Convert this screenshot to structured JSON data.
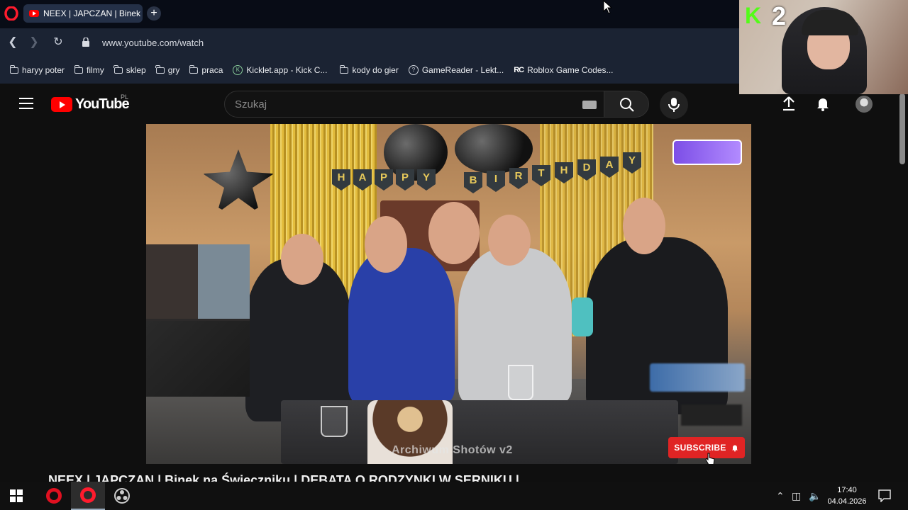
{
  "browser": {
    "tab_title": "NEEX | JAPCZAN | Binek na Świecznik",
    "url": "www.youtube.com/watch"
  },
  "bookmarks": [
    {
      "label": "haryy poter",
      "icon": "folder-icon"
    },
    {
      "label": "filmy",
      "icon": "folder-icon"
    },
    {
      "label": "sklep",
      "icon": "folder-icon"
    },
    {
      "label": "gry",
      "icon": "folder-icon"
    },
    {
      "label": "praca",
      "icon": "folder-icon"
    },
    {
      "label": "Kicklet.app - Kick C...",
      "icon": "kicklet-icon"
    },
    {
      "label": "kody do gier",
      "icon": "folder-icon"
    },
    {
      "label": "GameReader - Lekt...",
      "icon": "gamereader-icon"
    },
    {
      "label": "Roblox Game Codes...",
      "icon": "rc-icon"
    }
  ],
  "youtube": {
    "logo_text": "YouTube",
    "region": "PL",
    "search_placeholder": "Szukaj"
  },
  "video": {
    "banner_letters": [
      "H",
      "A",
      "P",
      "P",
      "Y",
      "B",
      "I",
      "R",
      "T",
      "H",
      "D",
      "A",
      "Y"
    ],
    "watermark": "Archiwum Shotów v2",
    "subscribe_label": "SUBSCRIBE",
    "title": "NEEX | JAPCZAN | Binek na Świeczniku | DEBATA O RODZYNKI W SERNIKU |"
  },
  "webcam": {
    "kick_letter": "K",
    "counter": "2"
  },
  "taskbar": {
    "time": "17:40",
    "date": "04.04.2026"
  },
  "colors": {
    "youtube_red": "#ff0000",
    "kick_green": "#53fc18",
    "opera_red": "#ff1b2d",
    "subscribe_red": "#e02424"
  }
}
